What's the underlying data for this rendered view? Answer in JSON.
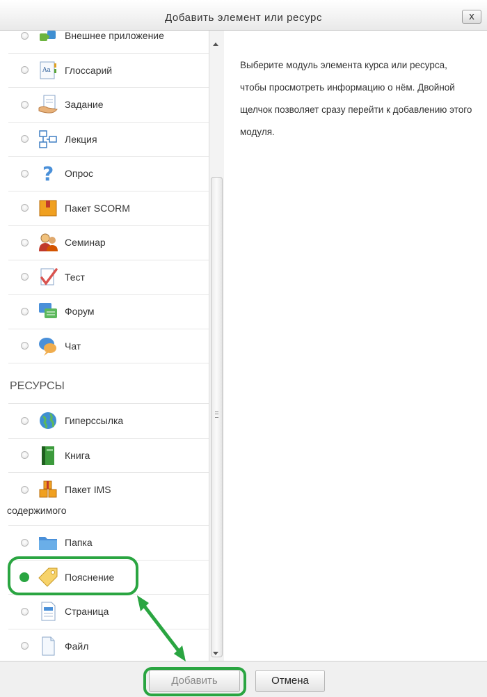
{
  "dialog": {
    "title": "Добавить элемент или ресурс",
    "close_label": "x"
  },
  "activities": [
    {
      "label": "Внешнее приложение",
      "icon": "puzzle-icon",
      "checked": false
    },
    {
      "label": "Глоссарий",
      "icon": "glossary-icon",
      "checked": false
    },
    {
      "label": "Задание",
      "icon": "assignment-icon",
      "checked": false
    },
    {
      "label": "Лекция",
      "icon": "lesson-icon",
      "checked": false
    },
    {
      "label": "Опрос",
      "icon": "question-icon",
      "checked": false
    },
    {
      "label": "Пакет SCORM",
      "icon": "scorm-package-icon",
      "checked": false
    },
    {
      "label": "Семинар",
      "icon": "workshop-icon",
      "checked": false
    },
    {
      "label": "Тест",
      "icon": "quiz-checkmark-icon",
      "checked": false
    },
    {
      "label": "Форум",
      "icon": "forum-icon",
      "checked": false
    },
    {
      "label": "Чат",
      "icon": "chat-icon",
      "checked": false
    }
  ],
  "resources_header": "РЕСУРСЫ",
  "resources": [
    {
      "label": "Гиперссылка",
      "icon": "globe-icon",
      "checked": false
    },
    {
      "label": "Книга",
      "icon": "book-icon",
      "checked": false
    },
    {
      "label": "Пакет IMS",
      "label2": "содержимого",
      "icon": "ims-package-icon",
      "checked": false
    },
    {
      "label": "Папка",
      "icon": "folder-icon",
      "checked": false
    },
    {
      "label": "Пояснение",
      "icon": "label-tag-icon",
      "checked": true
    },
    {
      "label": "Страница",
      "icon": "page-icon",
      "checked": false
    },
    {
      "label": "Файл",
      "icon": "file-icon",
      "checked": false
    }
  ],
  "info_text": "Выберите модуль элемента курса или ресурса, чтобы просмотреть информацию о нём. Двойной щелчок позволяет сразу перейти к добавлению этого модуля.",
  "footer": {
    "add_label": "Добавить",
    "cancel_label": "Отмена"
  },
  "colors": {
    "annotation_green": "#2aa541",
    "selected_radio": "#2aa541"
  }
}
